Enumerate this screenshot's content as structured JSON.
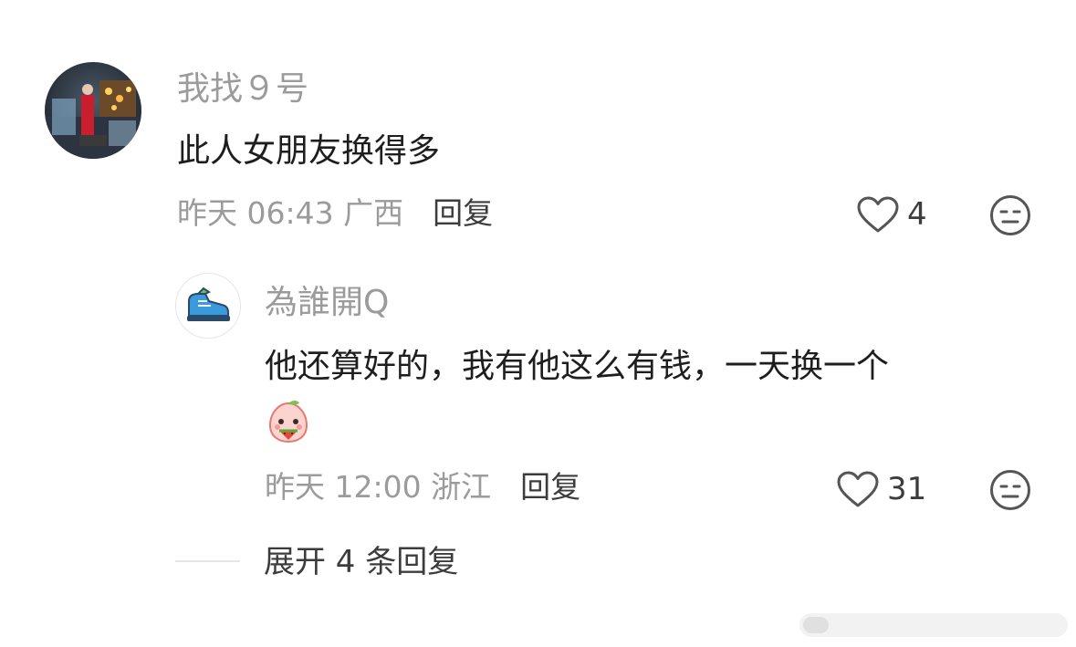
{
  "comment": {
    "username": "我找９号",
    "text": "此人女朋友换得多",
    "time_location": "昨天 06:43 广西",
    "reply_label": "回复",
    "like_count": "4",
    "avatar_icon": "photo-avatar"
  },
  "reply": {
    "username": "為誰開Q",
    "text": "他还算好的，我有他这么有钱，一天换一个",
    "emoji_icon": "peach-eating-watermelon",
    "time_location": "昨天 12:00 浙江",
    "reply_label": "回复",
    "like_count": "31",
    "avatar_icon": "sneaker-avatar"
  },
  "expand": {
    "label": "展开 4 条回复"
  },
  "colors": {
    "username": "#9b9b9b",
    "text": "#1e1e1e",
    "meta": "#9b9b9b",
    "action": "#3c3c3c",
    "icon": "#555555"
  }
}
